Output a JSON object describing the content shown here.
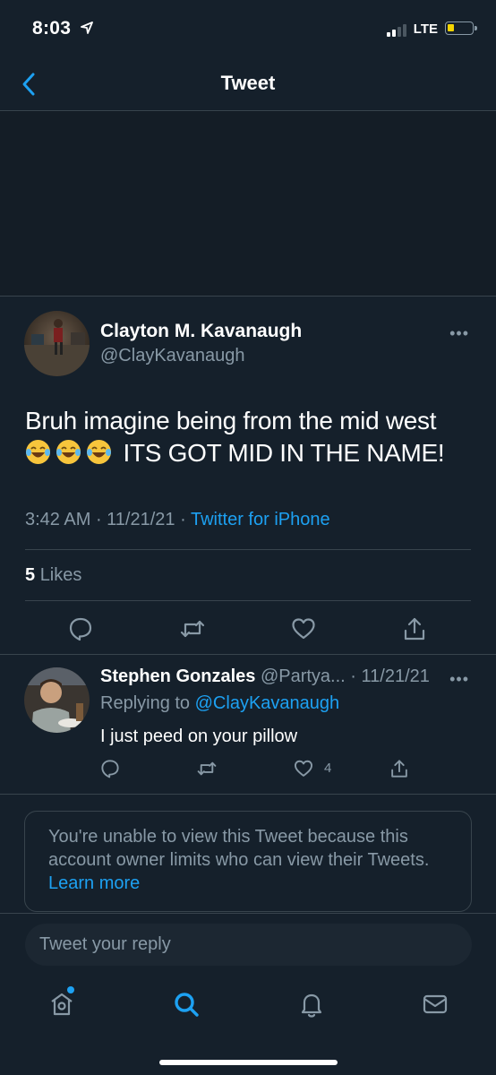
{
  "status_bar": {
    "time": "8:03",
    "network": "LTE"
  },
  "header": {
    "title": "Tweet"
  },
  "tweet": {
    "author_name": "Clayton M. Kavanaugh",
    "author_handle": "@ClayKavanaugh",
    "text_line1": "Bruh imagine being from the mid west",
    "text_line2": "ITS GOT MID IN THE NAME!",
    "emojis": [
      "joy-emoji",
      "joy-emoji",
      "joy-emoji"
    ],
    "time": "3:42 AM",
    "date": "11/21/21",
    "source": "Twitter for iPhone",
    "meta_sep": " · ",
    "likes_count": "5",
    "likes_label": "Likes"
  },
  "reply": {
    "author_name": "Stephen Gonzales",
    "author_handle": "@Partya...",
    "date": "· 11/21/21",
    "replying_label": "Replying to",
    "replying_to": "@ClayKavanaugh",
    "text": "I just peed on your pillow",
    "like_count": "4"
  },
  "notice": {
    "text": "You're unable to view this Tweet because this account owner limits who can view their Tweets.",
    "link": "Learn more"
  },
  "reply_box": {
    "placeholder": "Tweet your reply"
  },
  "tab_bar": {
    "tabs": [
      "home-icon",
      "search-icon",
      "notifications-icon",
      "messages-icon"
    ],
    "active": "search-icon"
  },
  "colors": {
    "background": "#15202b",
    "accent": "#1da1f2",
    "muted": "#8899a6",
    "divider": "#38444d"
  }
}
